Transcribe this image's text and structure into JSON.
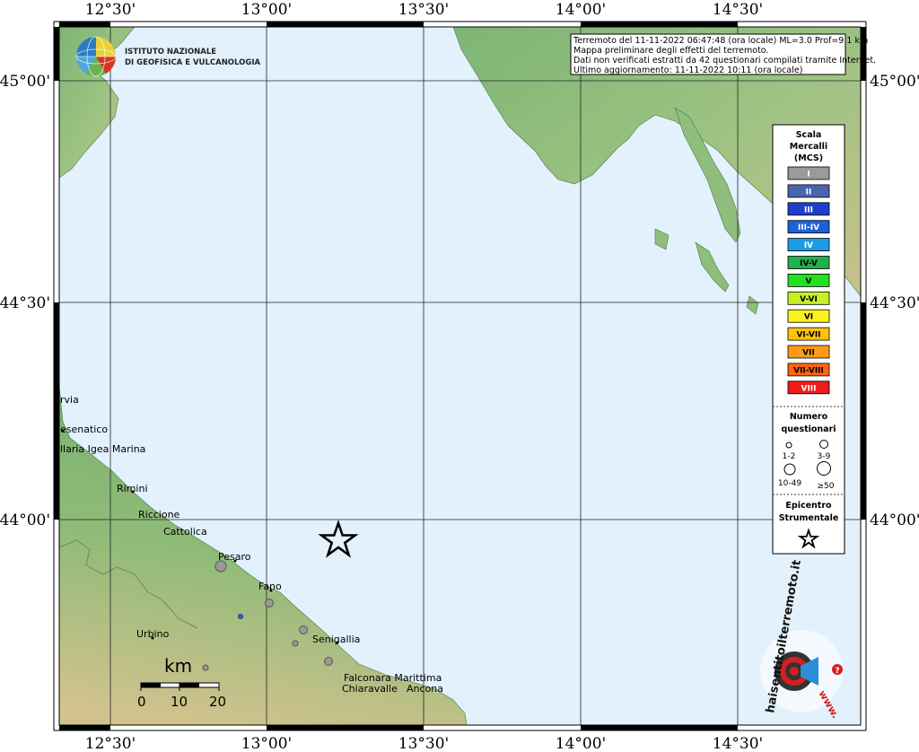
{
  "map": {
    "lon_ticks": [
      "12°30'",
      "13°00'",
      "13°30'",
      "14°00'",
      "14°30'"
    ],
    "lat_ticks": [
      "45°00'",
      "44°30'",
      "44°00'"
    ],
    "places": [
      {
        "name": "rvia"
      },
      {
        "name": "esenatico"
      },
      {
        "name": "llaria Igea Marina"
      },
      {
        "name": "Rimini"
      },
      {
        "name": "Riccione"
      },
      {
        "name": "Cattolica"
      },
      {
        "name": "Pesaro"
      },
      {
        "name": "Fano"
      },
      {
        "name": "Urbino"
      },
      {
        "name": "Senigallia"
      },
      {
        "name": "Falconara Marittima"
      },
      {
        "name": "Chiaravalle"
      },
      {
        "name": "Ancona"
      }
    ],
    "reports": [
      {
        "id": "r1",
        "size_class": "10-49",
        "color": "#999999"
      },
      {
        "id": "r2",
        "size_class": "3-9",
        "color": "#999999"
      },
      {
        "id": "r3",
        "size_class": "3-9",
        "color": "#999999"
      },
      {
        "id": "r4",
        "size_class": "3-9",
        "color": "#999999"
      },
      {
        "id": "r5",
        "size_class": "1-2",
        "color": "#999999"
      },
      {
        "id": "r6",
        "size_class": "1-2",
        "color": "#999999"
      },
      {
        "id": "r7",
        "size_class": "1-2",
        "color": "#3060c0"
      }
    ],
    "colors": {
      "sea": "#e2f1fc",
      "land_low": "#72ad6c",
      "land_high": "#d6c793",
      "grid": "#222222"
    }
  },
  "header": {
    "agency_line1": "ISTITUTO NAZIONALE",
    "agency_line2": "DI GEOFISICA E VULCANOLOGIA"
  },
  "info": {
    "line1": "Terremoto del 11-11-2022 06:47:48 (ora locale) ML=3.0 Prof=9.1 km",
    "line2": "Mappa preliminare degli effetti del terremoto.",
    "line3": "Dati non verificati estratti da 42 questionari compilati tramite Internet.",
    "line4": "Ultimo aggiornamento: 11-11-2022 10:11 (ora locale)"
  },
  "legend": {
    "scale_title": [
      "Scala",
      "Mercalli",
      "(MCS)"
    ],
    "intensities": [
      {
        "label": "I",
        "color": "#9a9a9a",
        "text": "#ffffff"
      },
      {
        "label": "II",
        "color": "#4a64b0",
        "text": "#ffffff"
      },
      {
        "label": "III",
        "color": "#1e3fcc",
        "text": "#ffffff"
      },
      {
        "label": "III-IV",
        "color": "#1b62d6",
        "text": "#ffffff"
      },
      {
        "label": "IV",
        "color": "#1e9be6",
        "text": "#ffffff"
      },
      {
        "label": "IV-V",
        "color": "#22b04e",
        "text": "#000000"
      },
      {
        "label": "V",
        "color": "#22e022",
        "text": "#000000"
      },
      {
        "label": "V-VI",
        "color": "#c8f028",
        "text": "#000000"
      },
      {
        "label": "VI",
        "color": "#fbf21f",
        "text": "#000000"
      },
      {
        "label": "VI-VII",
        "color": "#ffc20e",
        "text": "#000000"
      },
      {
        "label": "VII",
        "color": "#ff9a16",
        "text": "#000000"
      },
      {
        "label": "VII-VIII",
        "color": "#ff6412",
        "text": "#000000"
      },
      {
        "label": "VIII",
        "color": "#f01c1c",
        "text": "#ffffff"
      }
    ],
    "questionnaire_title": [
      "Numero",
      "questionari"
    ],
    "questionnaire_sizes": [
      "1-2",
      "3-9",
      "10-49",
      "≥50"
    ],
    "epicenter_title": [
      "Epicentro",
      "Strumentale"
    ]
  },
  "scalebar": {
    "unit": "km",
    "labels": [
      "0",
      "10",
      "20"
    ]
  },
  "watermark": {
    "text": "haisentitoilterremoto.it",
    "prefix": "www."
  }
}
